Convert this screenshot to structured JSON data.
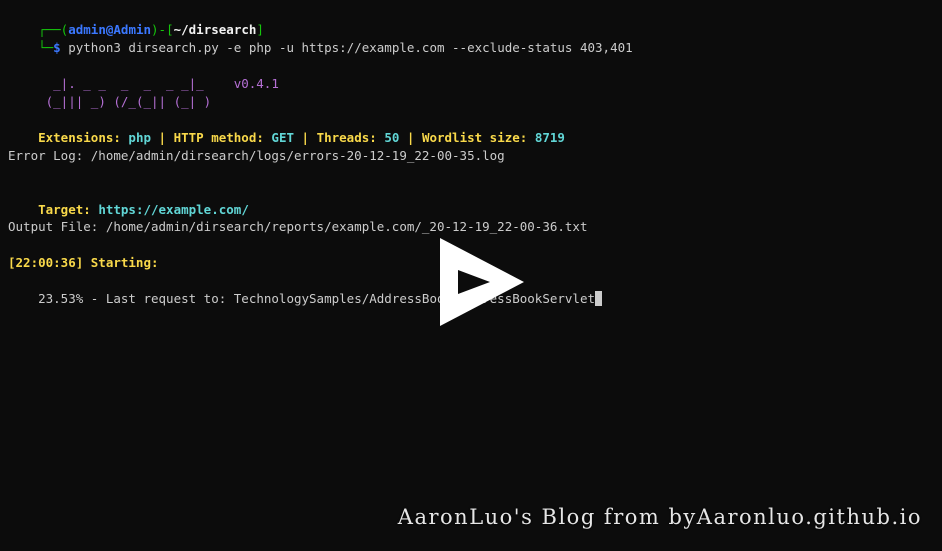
{
  "prompt": {
    "corner_top": "┌──(",
    "user": "admin",
    "at": "@",
    "host": "Admin",
    "sep": ")-[",
    "path": "~/dirsearch",
    "close": "]",
    "corner_bottom": "└─",
    "symbol": "$",
    "command": " python3 dirsearch.py -e php -u https://example.com --exclude-status 403,401"
  },
  "banner": {
    "logo_line1": "  _|. _ _  _  _  _ _|_",
    "logo_line2": " (_||| _) (/_(_|| (_| )",
    "version": "v0.4.1"
  },
  "config": {
    "extensions_label": "Extensions: ",
    "extensions_value": "php",
    "http_label": "HTTP method: ",
    "http_value": "GET",
    "threads_label": "Threads: ",
    "threads_value": "50",
    "wordlist_label": "Wordlist size: ",
    "wordlist_value": "8719",
    "separator": " | "
  },
  "error_log": "Error Log: /home/admin/dirsearch/logs/errors-20-12-19_22-00-35.log",
  "target": {
    "label": "Target: ",
    "url": "https://example.com/"
  },
  "output_file": "Output File: /home/admin/dirsearch/reports/example.com/_20-12-19_22-00-36.txt",
  "starting": "[22:00:36] Starting:",
  "progress": {
    "percent": "23.53%",
    "text": " - Last request to: TechnologySamples/AddressBook/AddressBookServlet"
  },
  "watermark": "AaronLuo's Blog from byAaronluo.github.io",
  "colors": {
    "background": "#0c0c0c",
    "prompt_green": "#16c60c",
    "user_blue": "#3b78ff",
    "label_yellow": "#f9d94a",
    "value_cyan": "#61d6d6",
    "logo_violet": "#b670d6"
  }
}
